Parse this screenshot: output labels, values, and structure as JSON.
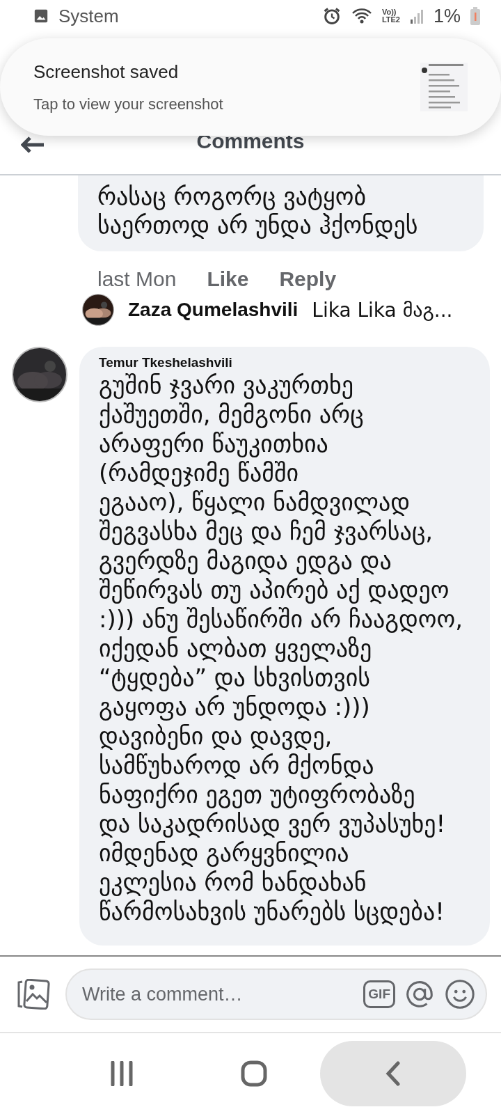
{
  "status_bar": {
    "app": "System",
    "volte": "Vo))",
    "network": "LTE2",
    "battery": "1%",
    "battery_low": true
  },
  "notification": {
    "title": "Screenshot saved",
    "subtitle": "Tap to view your screenshot"
  },
  "header": {
    "title": "Comments"
  },
  "comments": [
    {
      "lines": [
        "რასაც როგორც ვატყობ",
        "საერთოდ არ უნდა ჰქონდეს"
      ],
      "time": "last Mon",
      "like": "Like",
      "reply": "Reply",
      "reply_preview": {
        "name": "Zaza Qumelashvili",
        "text": "Lika Lika მაგ..."
      }
    },
    {
      "author": "Temur Tkeshelashvili",
      "lines": [
        "გუშინ ჯვარი ვაკურთხე",
        "ქაშუეთში, მემგონი არც",
        "არაფერი წაუკითხია",
        "(რამდეჯიმე წამში",
        "ეგააო), წყალი ნამდვილად",
        "შეგვასხა მეც და ჩემ ჯვარსაც,",
        "გვერდზე მაგიდა ედგა და",
        "შეწირვას თუ აპირებ აქ დადეო",
        ":))) ანუ შესაწირში არ ჩააგდოო,",
        "იქედან ალბათ ყველაზე",
        "“ტყდება” და სხვისთვის",
        "გაყოფა არ უნდოდა :)))",
        "დავიბენი და დავდე,",
        "სამწუხაროდ არ მქონდა",
        "ნაფიქრი ეგეთ უტიფრობაზე",
        "და საკადრისად ვერ ვუპასუხე!",
        "იმდენად გარყვნილია",
        "ეკლესია რომ ხანდახან",
        "წარმოსახვის უნარებს სცდება!"
      ]
    }
  ],
  "composer": {
    "placeholder": "Write a comment…",
    "gif": "GIF"
  }
}
